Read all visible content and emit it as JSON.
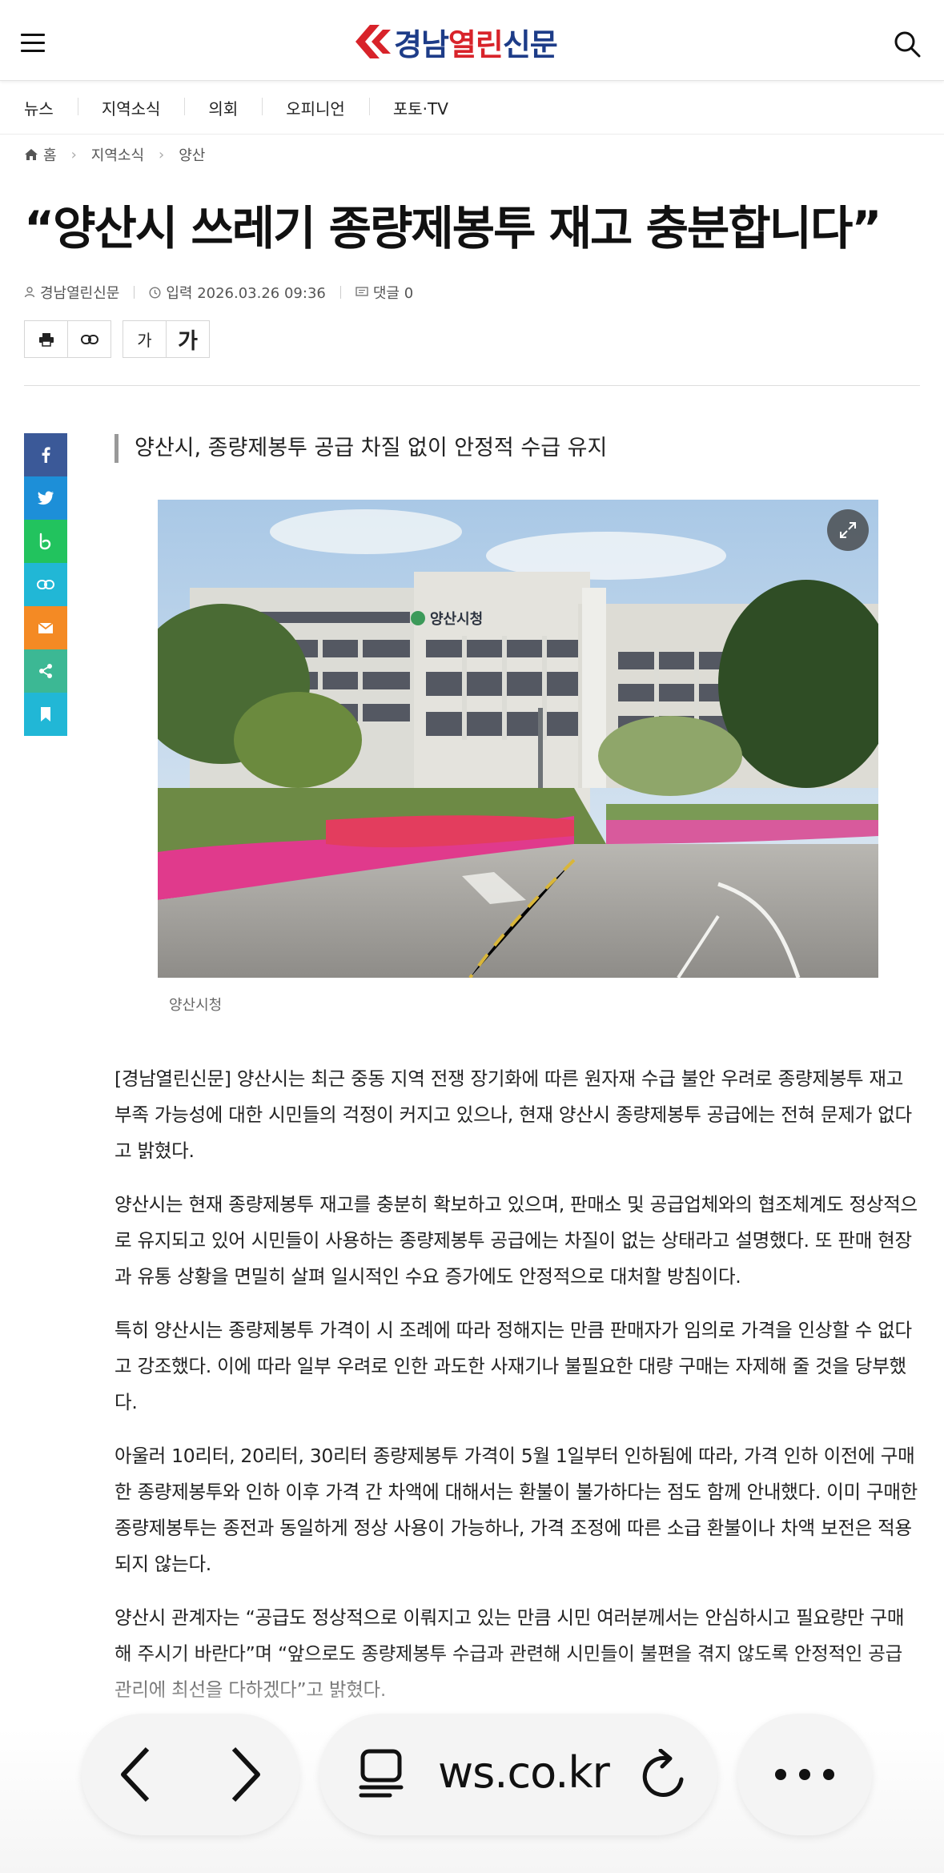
{
  "header": {
    "logo_part1": "경남",
    "logo_part2": "열린",
    "logo_part3": "신문"
  },
  "nav": {
    "items": [
      "뉴스",
      "지역소식",
      "의회",
      "오피니언",
      "포토·TV"
    ]
  },
  "breadcrumb": {
    "home": "홈",
    "level1": "지역소식",
    "level2": "양산"
  },
  "article": {
    "title": "“양산시 쓰레기 종량제봉투 재고 충분합니다”",
    "author": "경남열린신문",
    "date": "입력 2026.03.26 09:36",
    "comments": "댓글 0",
    "font_small": "가",
    "font_large": "가",
    "subtitle": "양산시, 종량제봉투 공급 차질 없이 안정적 수급 유지",
    "photo_caption": "양산시청",
    "photo_sign": "양산시청",
    "paragraphs": [
      "[경남열린신문] 양산시는 최근 중동 지역 전쟁 장기화에 따른 원자재 수급 불안 우려로 종량제봉투 재고 부족 가능성에 대한 시민들의 걱정이 커지고 있으나, 현재 양산시 종량제봉투 공급에는 전혀 문제가 없다고 밝혔다.",
      "양산시는 현재 종량제봉투 재고를 충분히 확보하고 있으며, 판매소 및 공급업체와의 협조체계도 정상적으로 유지되고 있어 시민들이 사용하는 종량제봉투 공급에는 차질이 없는 상태라고 설명했다. 또 판매 현장과 유통 상황을 면밀히 살펴 일시적인 수요 증가에도 안정적으로 대처할 방침이다.",
      "특히 양산시는 종량제봉투 가격이 시 조례에 따라 정해지는 만큼 판매자가 임의로 가격을 인상할 수 없다고 강조했다. 이에 따라 일부 우려로 인한 과도한 사재기나 불필요한 대량 구매는 자제해 줄 것을 당부했다.",
      "아울러 10리터, 20리터, 30리터 종량제봉투 가격이 5월 1일부터 인하됨에 따라, 가격 인하 이전에 구매한 종량제봉투와 인하 이후 가격 간 차액에 대해서는 환불이 불가하다는 점도 함께 안내했다. 이미 구매한 종량제봉투는 종전과 동일하게 정상 사용이 가능하나, 가격 조정에 따른 소급 환불이나 차액 보전은 적용되지 않는다.",
      "양산시 관계자는 “공급도 정상적으로 이뤄지고 있는 만큼 시민 여러분께서는 안심하시고 필요량만 구매해 주시기 바란다”며 “앞으로도 종량제봉투 수급과 관련해 시민들이 불편을 겪지 않도록 안정적인 공급 관리에 최선을 다하겠다”고 밝혔다."
    ]
  },
  "share_icons": [
    "facebook-icon",
    "twitter-icon",
    "band-icon",
    "link-icon",
    "mail-icon",
    "share-icon",
    "bookmark-icon"
  ],
  "share_colors": [
    "#3b5998",
    "#1d8fd8",
    "#22c35e",
    "#21b7d6",
    "#f48a24",
    "#3cb894",
    "#21b7d6"
  ],
  "browser": {
    "url": "ws.co.kr"
  },
  "colors": {
    "logo_blue": "#1d3c88",
    "logo_red": "#d8232a"
  }
}
